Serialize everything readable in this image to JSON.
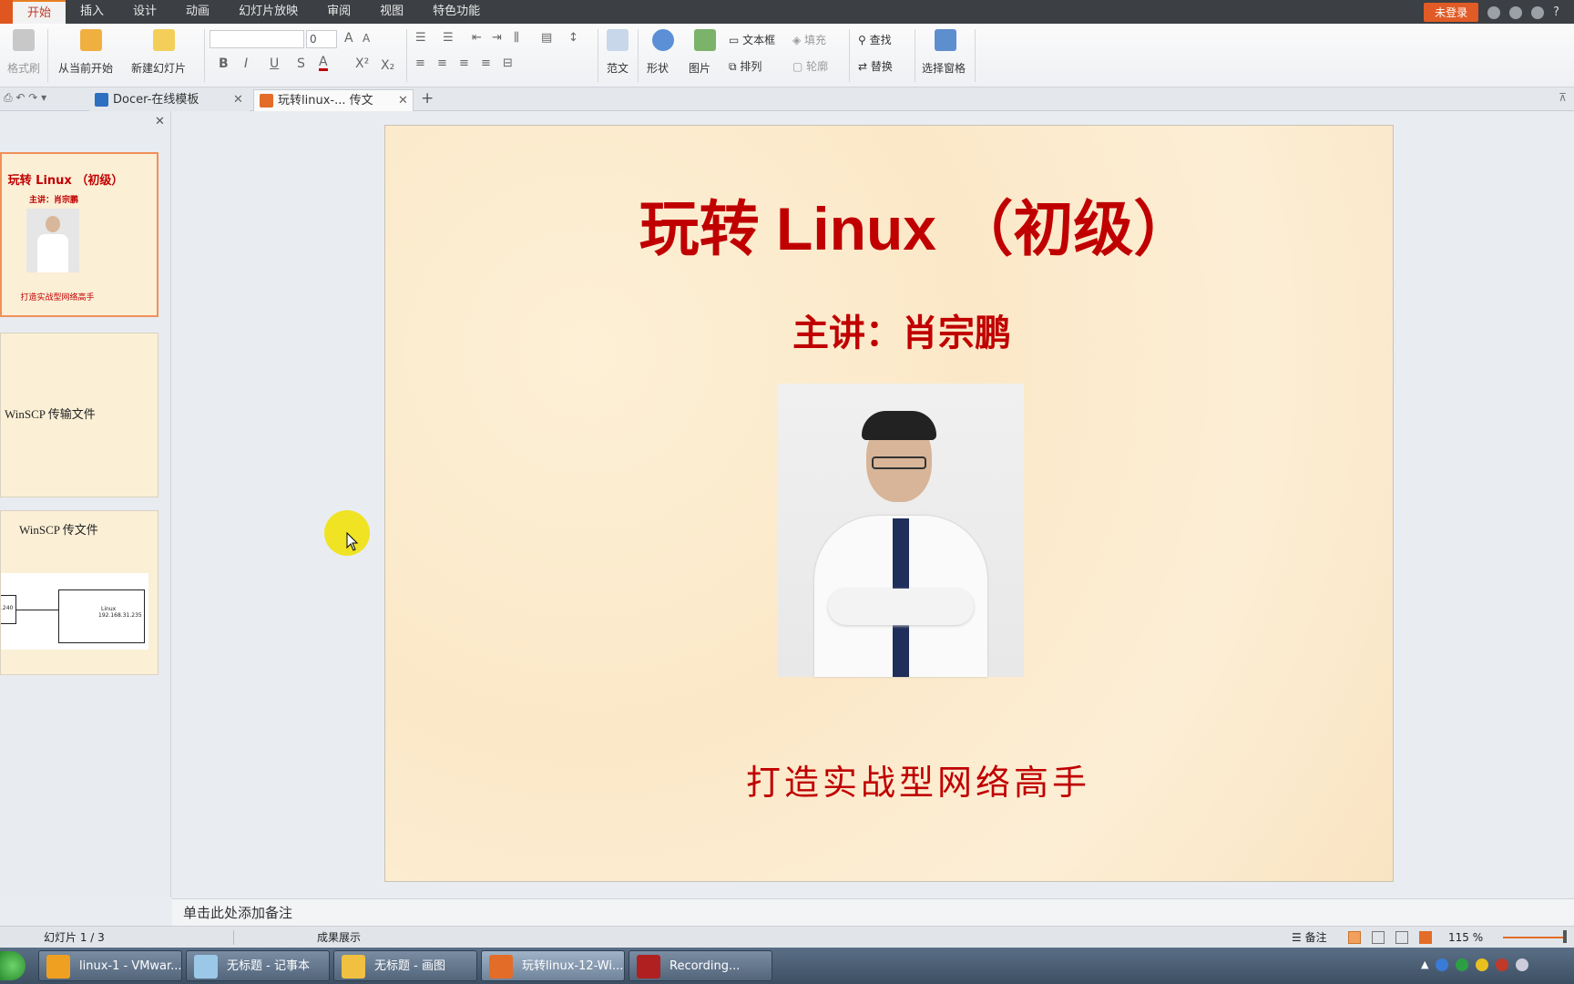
{
  "menubar": {
    "items": [
      "开始",
      "插入",
      "设计",
      "动画",
      "幻灯片放映",
      "审阅",
      "视图",
      "特色功能"
    ],
    "login_label": "未登录",
    "help_label": "?"
  },
  "ribbon": {
    "format_painter": "格式刷",
    "from_current": "从当前开始",
    "new_slide": "新建幻灯片",
    "font_size": "0",
    "template": "范文",
    "shapes": "形状",
    "picture": "图片",
    "textbox": "文本框",
    "arrange": "排列",
    "fill": "填充",
    "outline": "轮廓",
    "find": "查找",
    "replace": "替换",
    "select_pane": "选择窗格"
  },
  "tabs": [
    {
      "label": "Docer-在线模板"
    },
    {
      "label": "玩转linux-... 传文件.ppt"
    }
  ],
  "thumbnails": {
    "t1_title": "玩转 Linux （初级）",
    "t1_sub": "主讲：肖宗鹏",
    "t1_footer": "打造实战型网络高手",
    "t2_text": "WinSCP 传输文件",
    "t3_title": "WinSCP 传文件",
    "t3_left": ".240",
    "t3_box_title": "Linux",
    "t3_box_ip": "192.168.31.235"
  },
  "slide": {
    "title": "玩转 Linux （初级）",
    "subtitle": "主讲：肖宗鹏",
    "footer": "打造实战型网络高手"
  },
  "notes": {
    "placeholder": "单击此处添加备注"
  },
  "status": {
    "slide_info": "幻灯片 1 / 3",
    "theme": "成果展示",
    "notes_btn": "备注",
    "zoom": "115 %"
  },
  "taskbar": [
    {
      "label": "linux-1 - VMwar...",
      "color": "#f0a020"
    },
    {
      "label": "无标题 - 记事本",
      "color": "#9cc8e8"
    },
    {
      "label": "无标题 - 画图",
      "color": "#f0c040"
    },
    {
      "label": "玩转linux-12-Wi...",
      "color": "#e36c28"
    },
    {
      "label": "Recording...",
      "color": "#b02020"
    }
  ],
  "colors": {
    "accent": "#c00000",
    "brand": "#e15b26"
  }
}
